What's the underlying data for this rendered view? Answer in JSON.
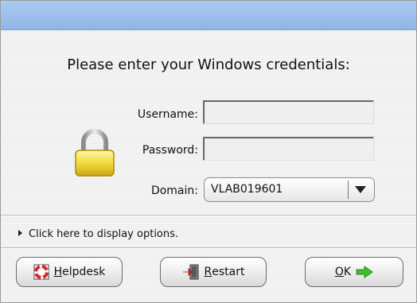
{
  "dialog": {
    "prompt": "Please enter your Windows credentials:"
  },
  "form": {
    "username_label": "Username:",
    "password_label": "Password:",
    "domain_label": "Domain:",
    "username_value": "",
    "password_value": "",
    "domain_value": "VLAB019601"
  },
  "options": {
    "label": "Click here to display options."
  },
  "buttons": {
    "helpdesk": {
      "mnemonic": "H",
      "rest": "elpdesk"
    },
    "restart": {
      "mnemonic": "R",
      "rest": "estart"
    },
    "ok": {
      "mnemonic": "O",
      "rest": "K"
    }
  },
  "icons": {
    "lock": "padlock-icon",
    "helpdesk": "lifebuoy-icon",
    "restart": "exit-door-icon",
    "ok": "arrow-right-icon"
  },
  "colors": {
    "titlebar": "#9cc0ec",
    "lock": "#e8d23a",
    "ok_arrow": "#3fbf2e",
    "helpdesk_ring": "#d62a2a"
  }
}
